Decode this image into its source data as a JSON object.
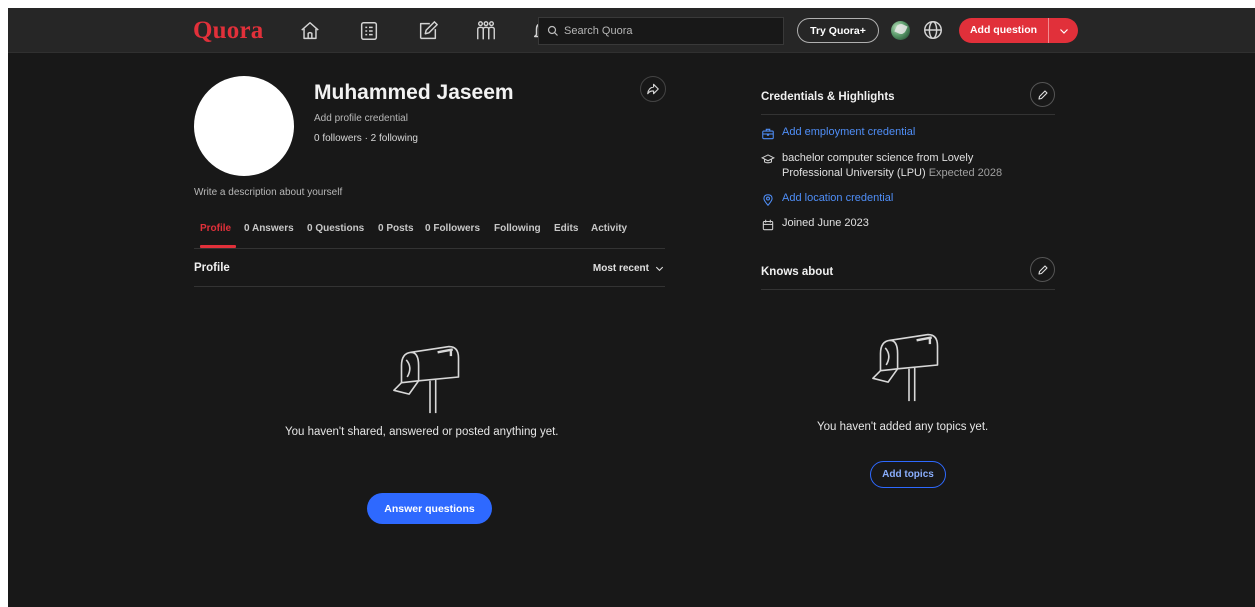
{
  "header": {
    "logo": "Quora",
    "search_placeholder": "Search Quora",
    "try_plus": "Try Quora+",
    "add_question": "Add question"
  },
  "profile": {
    "name": "Muhammed Jaseem",
    "credential_prompt": "Add profile credential",
    "followers_line": "0 followers · 2 following",
    "description_prompt": "Write a description about yourself",
    "tabs": [
      {
        "label": "Profile",
        "active": true
      },
      {
        "label": "0 Answers"
      },
      {
        "label": "0 Questions"
      },
      {
        "label": "0 Posts"
      },
      {
        "label": "0 Followers"
      },
      {
        "label": "Following"
      },
      {
        "label": "Edits"
      },
      {
        "label": "Activity"
      }
    ],
    "section_title": "Profile",
    "sort_label": "Most recent",
    "empty_message": "You haven't shared, answered or posted anything yet.",
    "answer_button": "Answer questions"
  },
  "credentials": {
    "title": "Credentials & Highlights",
    "employment": "Add employment credential",
    "education": "bachelor computer science from Lovely Professional University (LPU)",
    "education_line1": "bachelor computer science from Lovely",
    "education_line2": "Professional University (LPU)",
    "education_expected": "Expected 2028",
    "location": "Add location credential",
    "joined": "Joined June 2023"
  },
  "knows_about": {
    "title": "Knows about",
    "empty_message": "You haven't added any topics yet.",
    "add_button": "Add topics"
  },
  "colors": {
    "brand": "#e1303a",
    "link": "#4f8ef7",
    "primary_button": "#2e69ff",
    "background": "#181818",
    "topbar": "#262626"
  }
}
